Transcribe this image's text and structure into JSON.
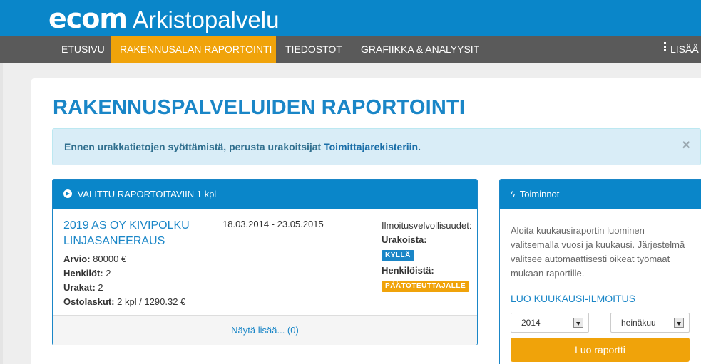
{
  "header": {
    "brand": "ecom",
    "product": "Arkistopalvelu"
  },
  "nav": {
    "items": [
      {
        "label": "ETUSIVU"
      },
      {
        "label": "RAKENNUSALAN RAPORTOINTI",
        "active": true
      },
      {
        "label": "TIEDOSTOT"
      },
      {
        "label": "GRAFIIKKA & ANALYYSIT"
      }
    ],
    "more_label": "LISÄÄ",
    "more_icon": "vertical-dots-icon"
  },
  "page": {
    "title": "RAKENNUSPALVELUIDEN RAPORTOINTI"
  },
  "alert": {
    "text": "Ennen urakkatietojen syöttämistä, perusta urakoitsijat ",
    "link": "Toimittajarekisteriin",
    "suffix": ".",
    "close": "×"
  },
  "selected_panel": {
    "header": "VALITTU RAPORTOITAVIIN 1 kpl",
    "project": {
      "title": "2019 AS OY KIVIPOLKU LINJASANEERAUS",
      "dates": "18.03.2014 - 23.05.2015",
      "fields": [
        {
          "label": "Arvio:",
          "value": "80000 €"
        },
        {
          "label": "Henkilöt:",
          "value": "2"
        },
        {
          "label": "Urakat:",
          "value": "2"
        },
        {
          "label": "Ostolaskut:",
          "value": "2 kpl / 1290.32 €"
        }
      ],
      "obligations": {
        "heading": "Ilmoitusvelvollisuudet:",
        "contracts_label": "Urakoista:",
        "contracts_badge": "KYLLÄ",
        "persons_label": "Henkilöistä:",
        "persons_badge": "PÄÄTOTEUTTAJALLE"
      }
    },
    "show_more": "Näytä lisää... (0)"
  },
  "actions_panel": {
    "header": "Toiminnot",
    "description": "Aloita kuukausiraportin luominen valitsemalla vuosi ja kuukausi. Järjestelmä valitsee automaattisesti oikeat työmaat mukaan raportille.",
    "link": "LUO KUUKAUSI-ILMOITUS",
    "year": "2014",
    "month": "heinäkuu",
    "button": "Luo raportti"
  },
  "colors": {
    "primary": "#0a86c9",
    "accent": "#f0a30a",
    "nav_bg": "#5a5a5a",
    "alert_bg": "#d9edf7"
  }
}
